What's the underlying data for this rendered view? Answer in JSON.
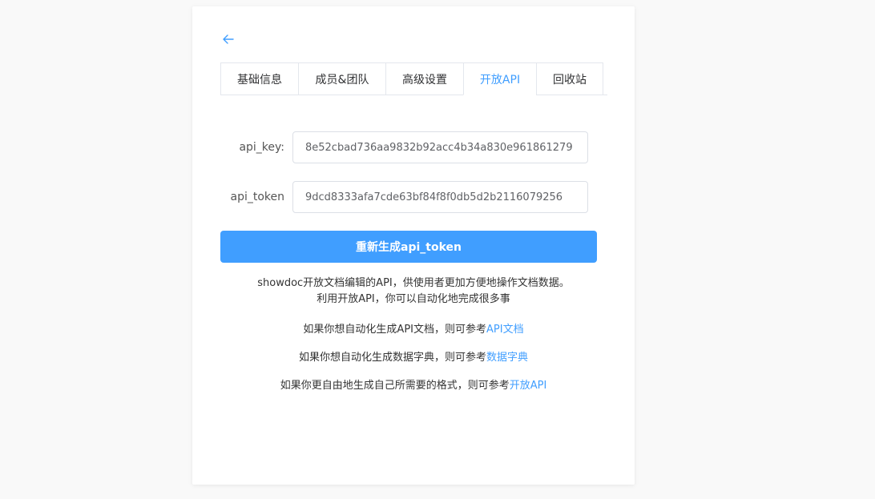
{
  "tabs": [
    {
      "label": "基础信息"
    },
    {
      "label": "成员&团队"
    },
    {
      "label": "高级设置"
    },
    {
      "label": "开放API"
    },
    {
      "label": "回收站"
    }
  ],
  "active_tab": "开放API",
  "form": {
    "api_key_label": "api_key:",
    "api_key_value": "8e52cbad736aa9832b92acc4b34a830e961861279",
    "api_token_label": "api_token",
    "api_token_value": "9dcd8333afa7cde63bf84f8f0db5d2b2116079256"
  },
  "regenerate_button": "重新生成api_token",
  "description": {
    "line1": "showdoc开放文档编辑的API，供使用者更加方便地操作文档数据。",
    "line2": "利用开放API，你可以自动化地完成很多事"
  },
  "notes": [
    {
      "text": "如果你想自动化生成API文档，则可参考",
      "link": "API文档"
    },
    {
      "text": "如果你想自动化生成数据字典，则可参考",
      "link": "数据字典"
    },
    {
      "text": "如果你更自由地生成自己所需要的格式，则可参考",
      "link": "开放API"
    }
  ],
  "colors": {
    "accent": "#409eff",
    "border": "#dcdfe6"
  },
  "icons": {
    "back": "arrow-left-icon"
  }
}
